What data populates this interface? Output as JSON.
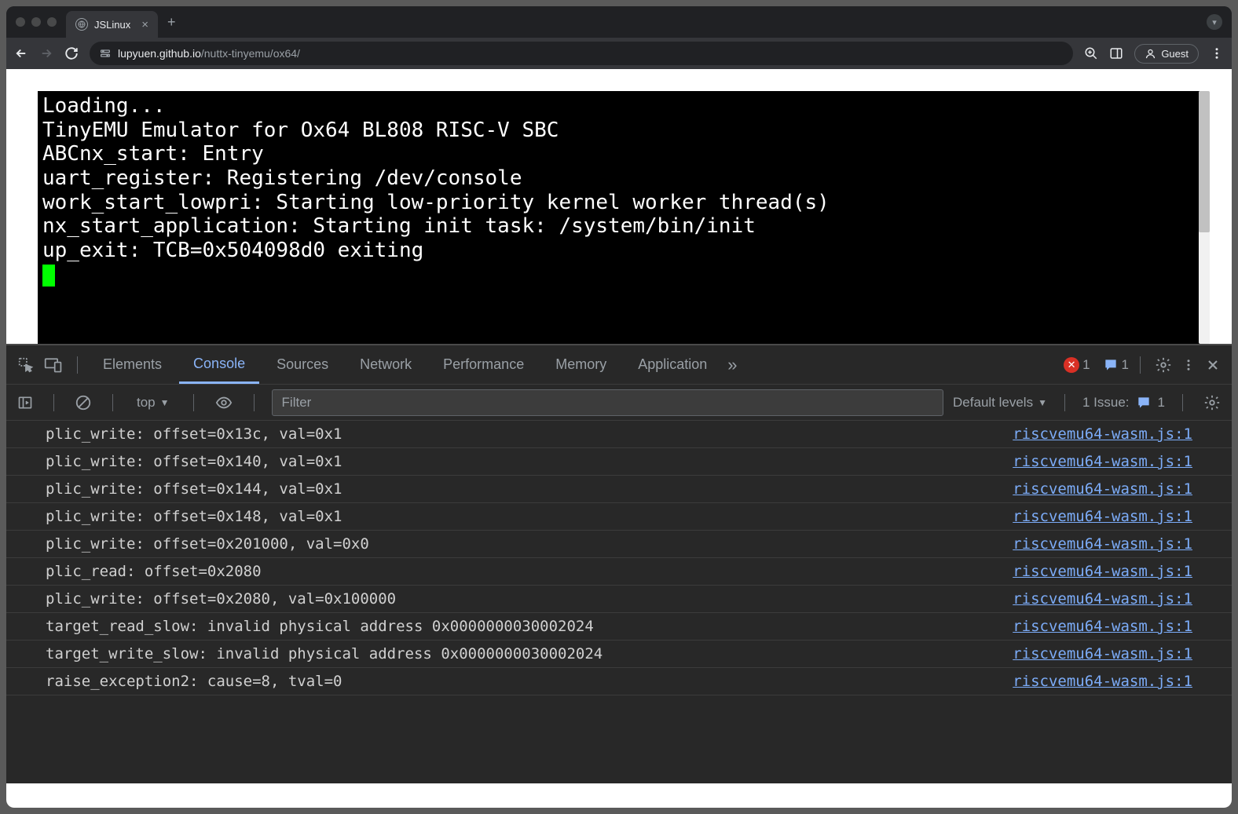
{
  "browser": {
    "tab_title": "JSLinux",
    "url_domain": "lupyuen.github.io",
    "url_path": "/nuttx-tinyemu/ox64/",
    "guest_label": "Guest"
  },
  "terminal": {
    "lines": [
      "Loading...",
      "TinyEMU Emulator for Ox64 BL808 RISC-V SBC",
      "ABCnx_start: Entry",
      "uart_register: Registering /dev/console",
      "work_start_lowpri: Starting low-priority kernel worker thread(s)",
      "nx_start_application: Starting init task: /system/bin/init",
      "up_exit: TCB=0x504098d0 exiting"
    ]
  },
  "devtools": {
    "tabs": [
      "Elements",
      "Console",
      "Sources",
      "Network",
      "Performance",
      "Memory",
      "Application"
    ],
    "active_tab": "Console",
    "error_count": "1",
    "info_count": "1",
    "context": "top",
    "filter_placeholder": "Filter",
    "levels_label": "Default levels",
    "issue_label": "1 Issue:",
    "issue_count": "1",
    "console_rows": [
      {
        "msg": "plic_write: offset=0x13c, val=0x1",
        "src": "riscvemu64-wasm.js:1"
      },
      {
        "msg": "plic_write: offset=0x140, val=0x1",
        "src": "riscvemu64-wasm.js:1"
      },
      {
        "msg": "plic_write: offset=0x144, val=0x1",
        "src": "riscvemu64-wasm.js:1"
      },
      {
        "msg": "plic_write: offset=0x148, val=0x1",
        "src": "riscvemu64-wasm.js:1"
      },
      {
        "msg": "plic_write: offset=0x201000, val=0x0",
        "src": "riscvemu64-wasm.js:1"
      },
      {
        "msg": "plic_read: offset=0x2080",
        "src": "riscvemu64-wasm.js:1"
      },
      {
        "msg": "plic_write: offset=0x2080, val=0x100000",
        "src": "riscvemu64-wasm.js:1"
      },
      {
        "msg": "target_read_slow: invalid physical address 0x0000000030002024",
        "src": "riscvemu64-wasm.js:1"
      },
      {
        "msg": "target_write_slow: invalid physical address 0x0000000030002024",
        "src": "riscvemu64-wasm.js:1"
      },
      {
        "msg": "raise_exception2: cause=8, tval=0",
        "src": "riscvemu64-wasm.js:1"
      }
    ]
  }
}
